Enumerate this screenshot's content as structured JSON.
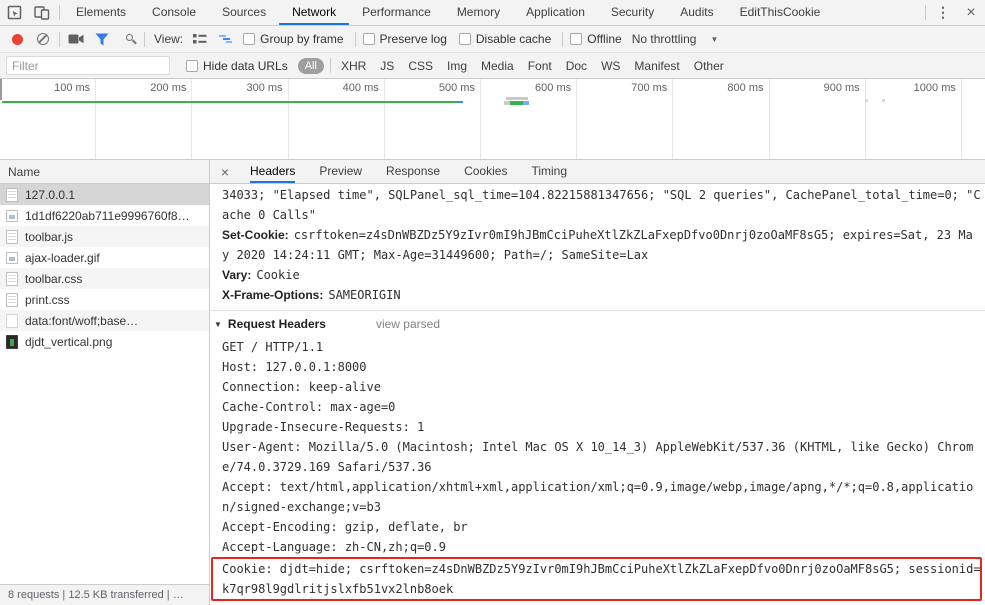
{
  "tabbar": {
    "tabs": [
      {
        "label": "Elements",
        "active": false
      },
      {
        "label": "Console",
        "active": false
      },
      {
        "label": "Sources",
        "active": false
      },
      {
        "label": "Network",
        "active": true
      },
      {
        "label": "Performance",
        "active": false
      },
      {
        "label": "Memory",
        "active": false
      },
      {
        "label": "Application",
        "active": false
      },
      {
        "label": "Security",
        "active": false
      },
      {
        "label": "Audits",
        "active": false
      },
      {
        "label": "EditThisCookie",
        "active": false
      }
    ],
    "menu_icon": "⋮",
    "close_icon": "×"
  },
  "toolbar": {
    "view_label": "View:",
    "group_by_frame": {
      "label": "Group by frame",
      "checked": false
    },
    "preserve_log": {
      "label": "Preserve log",
      "checked": false
    },
    "disable_cache": {
      "label": "Disable cache",
      "checked": false
    },
    "offline": {
      "label": "Offline",
      "checked": false
    },
    "throttling": {
      "value": "No throttling"
    },
    "dropdown_icon": "▼"
  },
  "filterbar": {
    "placeholder": "Filter",
    "hide_data_urls": {
      "label": "Hide data URLs",
      "checked": false
    },
    "selected_type": "All",
    "types": [
      "XHR",
      "JS",
      "CSS",
      "Img",
      "Media",
      "Font",
      "Doc",
      "WS",
      "Manifest",
      "Other"
    ]
  },
  "overview": {
    "ruler_labels": [
      "100 ms",
      "200 ms",
      "300 ms",
      "400 ms",
      "500 ms",
      "600 ms",
      "700 ms",
      "800 ms",
      "900 ms",
      "1000 ms"
    ]
  },
  "sidebar": {
    "header": "Name",
    "rows": [
      {
        "icon": "document",
        "label": "127.0.0.1",
        "selected": true
      },
      {
        "icon": "image",
        "label": "1d1df6220ab711e9996760f8…",
        "selected": false
      },
      {
        "icon": "document",
        "label": "toolbar.js",
        "selected": false
      },
      {
        "icon": "image",
        "label": "ajax-loader.gif",
        "selected": false
      },
      {
        "icon": "document",
        "label": "toolbar.css",
        "selected": false
      },
      {
        "icon": "document",
        "label": "print.css",
        "selected": false
      },
      {
        "icon": "blank",
        "label": "data:font/woff;base…",
        "selected": false
      },
      {
        "icon": "thumbnail",
        "label": "djdt_vertical.png",
        "selected": false
      }
    ],
    "status": "8 requests | 12.5 KB transferred | …"
  },
  "details": {
    "close_icon": "×",
    "tabs": [
      {
        "label": "Headers",
        "active": true
      },
      {
        "label": "Preview",
        "active": false
      },
      {
        "label": "Response",
        "active": false
      },
      {
        "label": "Cookies",
        "active": false
      },
      {
        "label": "Timing",
        "active": false
      }
    ],
    "response_lines": [
      {
        "name": "",
        "value": "34033; \"Elapsed time\", SQLPanel_sql_time=104.82215881347656; \"SQL 2 queries\", CachePanel_total_time=0; \"C"
      },
      {
        "name": "",
        "value": "ache 0 Calls\""
      },
      {
        "name": "Set-Cookie:",
        "value": "csrftoken=z4sDnWBZDz5Y9zIvr0mI9hJBmCciPuheXtlZkZLaFxepDfvo0Dnrj0zoOaMF8sG5; expires=Sat, 23 Ma"
      },
      {
        "name": "",
        "value": "y 2020 14:24:11 GMT; Max-Age=31449600; Path=/; SameSite=Lax"
      },
      {
        "name": "Vary:",
        "value": "Cookie"
      },
      {
        "name": "X-Frame-Options:",
        "value": "SAMEORIGIN"
      }
    ],
    "request_section": {
      "toggle": "▼",
      "title": "Request Headers",
      "link": "view parsed",
      "lines": [
        "GET / HTTP/1.1",
        "Host: 127.0.0.1:8000",
        "Connection: keep-alive",
        "Cache-Control: max-age=0",
        "Upgrade-Insecure-Requests: 1",
        "User-Agent: Mozilla/5.0 (Macintosh; Intel Mac OS X 10_14_3) AppleWebKit/537.36 (KHTML, like Gecko) Chrom",
        "e/74.0.3729.169 Safari/537.36",
        "Accept: text/html,application/xhtml+xml,application/xml;q=0.9,image/webp,image/apng,*/*;q=0.8,applicatio",
        "n/signed-exchange;v=b3",
        "Accept-Encoding: gzip, deflate, br",
        "Accept-Language: zh-CN,zh;q=0.9"
      ],
      "highlighted_lines": [
        "Cookie: djdt=hide; csrftoken=z4sDnWBZDz5Y9zIvr0mI9hJBmCciPuheXtlZkZLaFxepDfvo0Dnrj0zoOaMF8sG5; sessionid=",
        "k7qr98l9gdlritjslxfb51vx2lnb8oek"
      ]
    }
  },
  "colors": {
    "accent": "#1a73e8",
    "record_red": "#e94235",
    "overview_green": "#36b34a",
    "overview_blue": "#4285f4",
    "highlight_red": "#e8261f",
    "selected_row": "#d6d6d6"
  }
}
